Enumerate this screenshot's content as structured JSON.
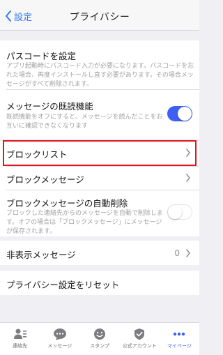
{
  "navbar": {
    "back_label": "設定",
    "title": "プライバシー"
  },
  "rows": {
    "passcode": {
      "title": "パスコードを設定",
      "desc": "アプリ起動時にパスコード入力が必要になります。パスコードを忘れた場合、再度インストールし直す必要があります。その場合メッセージがすべて削除されます。"
    },
    "read_receipt": {
      "title": "メッセージの既読機能",
      "desc": "既読機能をオフにすると、メッセージを読んだことをお互いに確認できなくなります",
      "toggle_on": true
    },
    "block_list": {
      "title": "ブロックリスト"
    },
    "block_messages": {
      "title": "ブロックメッセージ"
    },
    "auto_delete": {
      "title": "ブロックメッセージの自動削除",
      "desc": "ブロックした連絡先からのメッセージを自動で削除します。オフの場合は「ブロックメッセージ」にメッセージが保存されます。",
      "toggle_on": false
    },
    "hidden_messages": {
      "title": "非表示メッセージ",
      "count": "0"
    },
    "reset": {
      "title": "プライバシー設定をリセット"
    }
  },
  "tabbar": {
    "tabs": [
      {
        "label": "連絡先",
        "icon": "contacts-icon"
      },
      {
        "label": "メッセージ",
        "icon": "chat-bubble-icon"
      },
      {
        "label": "スタンプ",
        "icon": "smiley-icon"
      },
      {
        "label": "公式アカウント",
        "icon": "shield-check-icon"
      },
      {
        "label": "マイページ",
        "icon": "more-dots-icon",
        "active": true
      }
    ]
  },
  "colors": {
    "accent": "#3e5ff5",
    "link": "#3478f6",
    "highlight_border": "#e1141f",
    "background": "#efeff4"
  }
}
